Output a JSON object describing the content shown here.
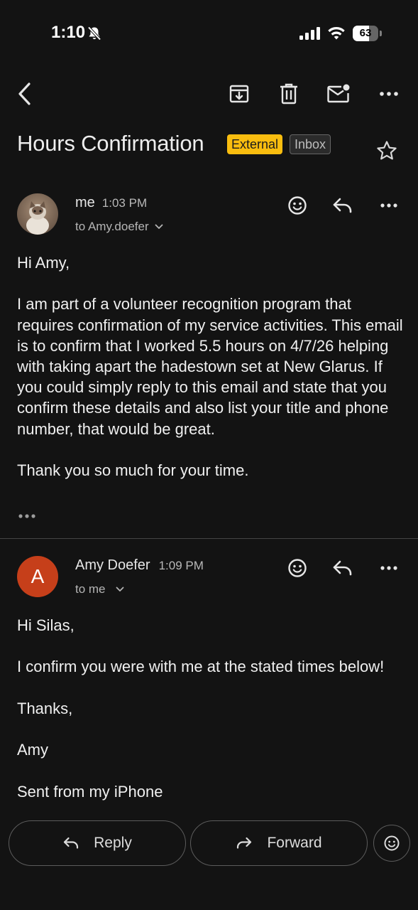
{
  "status_bar": {
    "time": "1:10",
    "battery": "63",
    "battery_level": 0.63
  },
  "toolbar": {
    "back": "back-arrow-icon",
    "archive": "archive-icon",
    "delete": "trash-icon",
    "mark_unread": "mark-unread-icon",
    "more": "more-horizontal-icon"
  },
  "thread": {
    "subject": "Hours Confirmation",
    "labels": [
      "External",
      "Inbox"
    ],
    "starred": false
  },
  "messages": [
    {
      "sender": "me",
      "time": "1:03 PM",
      "recipient": "to Amy.doefer",
      "body": "Hi Amy,\n\nI am part of a volunteer recognition program that requires confirmation of my service activities. This email is to confirm that I worked 5.5 hours on 4/7/26 helping with taking apart the hadestown set at New Glarus. If you could simply reply to this email and state that you confirm these details and also list your title and phone number, that would be great.\n\nThank you so much for your time."
    },
    {
      "sender": "Amy Doefer",
      "avatar_letter": "A",
      "avatar_color": "#c63f1a",
      "time": "1:09 PM",
      "recipient": "to me",
      "body": "Hi Silas,\n\nI confirm you were with me at the stated times below!\n\nThanks,\n\nAmy\n\nSent from my iPhone"
    }
  ],
  "actions": {
    "reply": "Reply",
    "forward": "Forward"
  },
  "colors": {
    "background": "#131313",
    "external_chip": "#f9bd0f",
    "avatar": "#c63f1a"
  }
}
